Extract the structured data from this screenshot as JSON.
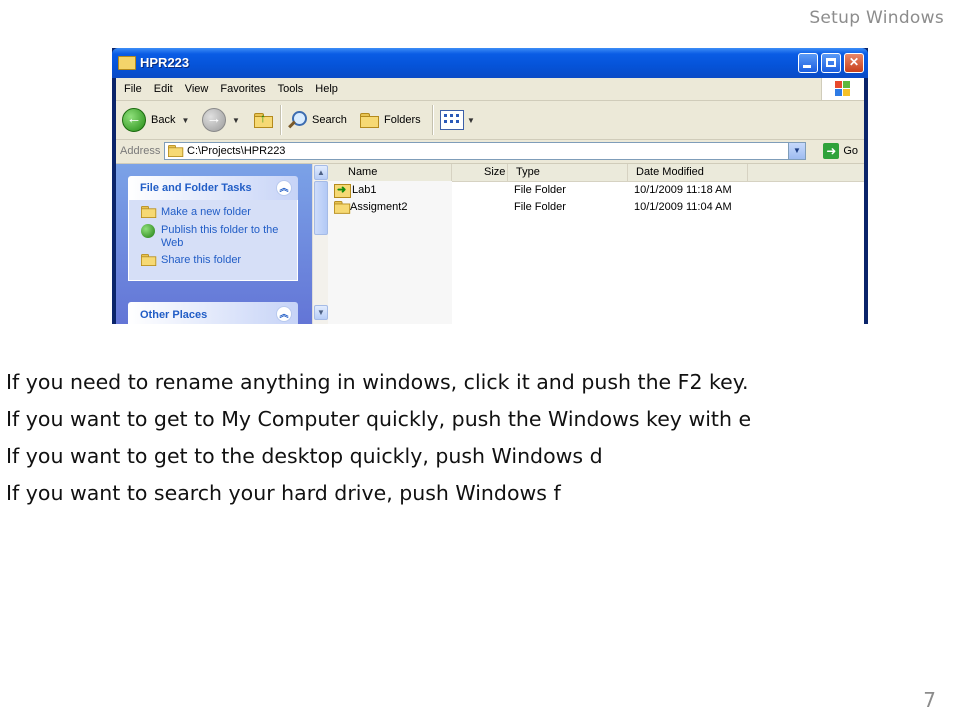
{
  "slide": {
    "title": "Setup Windows",
    "page_number": "7"
  },
  "window": {
    "title": "HPR223",
    "menu": [
      "File",
      "Edit",
      "View",
      "Favorites",
      "Tools",
      "Help"
    ],
    "toolbar": {
      "back": "Back",
      "search": "Search",
      "folders": "Folders"
    },
    "address": {
      "label": "Address",
      "value": "C:\\Projects\\HPR223",
      "go": "Go"
    },
    "taskpane": {
      "file_tasks": {
        "title": "File and Folder Tasks",
        "items": [
          "Make a new folder",
          "Publish this folder to the Web",
          "Share this folder"
        ]
      },
      "other_places": {
        "title": "Other Places"
      }
    },
    "columns": [
      "Name",
      "Size",
      "Type",
      "Date Modified"
    ],
    "files": [
      {
        "name": "Lab1",
        "size": "",
        "type": "File Folder",
        "date": "10/1/2009 11:18 AM",
        "icon": "shortcut-folder-icon"
      },
      {
        "name": "Assigment2",
        "size": "",
        "type": "File Folder",
        "date": "10/1/2009 11:04 AM",
        "icon": "folder-icon"
      }
    ]
  },
  "tips": [
    "If you need to rename anything in windows, click it and push the F2 key.",
    "If you want to get to My Computer quickly, push the Windows key with e",
    "If you want to get to the desktop quickly, push Windows d",
    "If you want to search your hard drive, push Windows f"
  ],
  "colors": {
    "titlebar": "#0553d8",
    "taskpane_link": "#215dc6",
    "slide_gray": "#8c8c8c"
  }
}
